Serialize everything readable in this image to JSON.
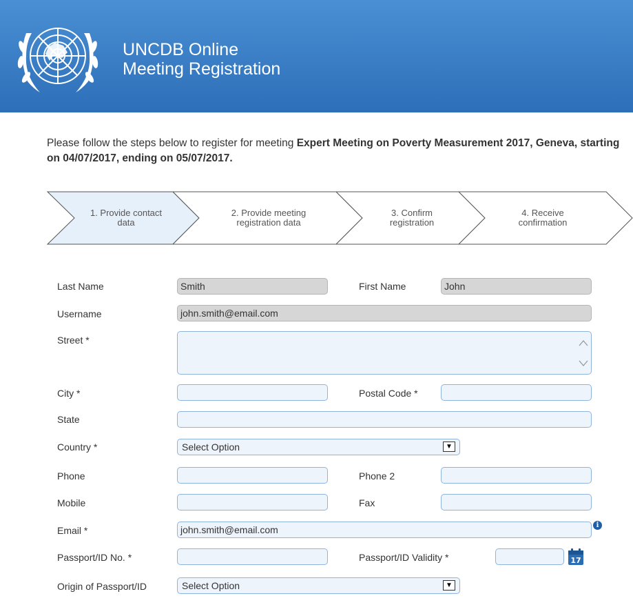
{
  "header": {
    "title_line1": "UNCDB Online",
    "title_line2": "Meeting Registration"
  },
  "intro": {
    "prefix": "Please follow the steps below to register for meeting ",
    "bold": "Expert Meeting on Poverty Measurement 2017, Geneva, starting on 04/07/2017, ending on 05/07/2017."
  },
  "steps": [
    {
      "line1": "1. Provide contact",
      "line2": "data",
      "active": true
    },
    {
      "line1": "2. Provide meeting",
      "line2": "registration data",
      "active": false
    },
    {
      "line1": "3. Confirm",
      "line2": "registration",
      "active": false
    },
    {
      "line1": "4. Receive",
      "line2": "confirmation",
      "active": false
    }
  ],
  "form": {
    "last_name": {
      "label": "Last Name",
      "value": "Smith"
    },
    "first_name": {
      "label": "First Name",
      "value": "John"
    },
    "username": {
      "label": "Username",
      "value": "john.smith@email.com"
    },
    "street": {
      "label": "Street *",
      "value": ""
    },
    "city": {
      "label": "City *",
      "value": ""
    },
    "postal_code": {
      "label": "Postal Code *",
      "value": ""
    },
    "state": {
      "label": "State",
      "value": ""
    },
    "country": {
      "label": "Country *",
      "selected": "Select Option"
    },
    "phone": {
      "label": "Phone",
      "value": ""
    },
    "phone2": {
      "label": "Phone 2",
      "value": ""
    },
    "mobile": {
      "label": "Mobile",
      "value": ""
    },
    "fax": {
      "label": "Fax",
      "value": ""
    },
    "email": {
      "label": "Email *",
      "value": "john.smith@email.com"
    },
    "passport_no": {
      "label": "Passport/ID No. *",
      "value": ""
    },
    "passport_validity": {
      "label": "Passport/ID Validity *",
      "value": ""
    },
    "passport_origin": {
      "label": "Origin of Passport/ID",
      "selected": "Select Option"
    }
  },
  "icons": {
    "info": "i",
    "calendar_day": "17",
    "dropdown": "▼"
  },
  "colors": {
    "header": "#3a7fc8",
    "input_bg": "#eef4fc",
    "input_border": "#8fb4dc",
    "readonly_bg": "#d6d6d6",
    "active_step": "#e6f0fb"
  }
}
